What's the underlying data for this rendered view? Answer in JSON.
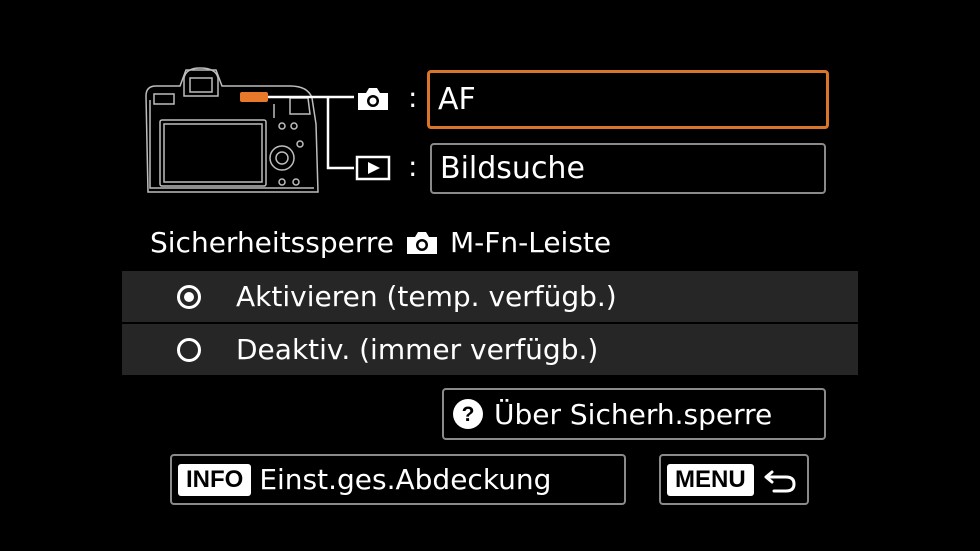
{
  "assignments": {
    "shooting": {
      "icon": "camera-icon",
      "separator": ":",
      "value": "AF"
    },
    "playback": {
      "icon": "playback-icon",
      "separator": ":",
      "value": "Bildsuche"
    }
  },
  "section": {
    "title_prefix": "Sicherheitssperre",
    "title_icon": "camera-icon",
    "title_suffix": "M-Fn-Leiste"
  },
  "options": [
    {
      "label": "Aktivieren (temp. verfügb.)",
      "selected": true
    },
    {
      "label": "Deaktiv. (immer verfügb.)",
      "selected": false
    }
  ],
  "help_button": {
    "icon": "question-icon",
    "label": "Über Sicherh.sperre"
  },
  "footer": {
    "info_key": "INFO",
    "info_label": "Einst.ges.Abdeckung",
    "menu_key": "MENU",
    "menu_icon": "back-arrow-icon"
  },
  "colors": {
    "background": "#000000",
    "row_background": "#262626",
    "selected_border": "#d9752b",
    "highlight_bar": "#e8792a",
    "border": "#8a8a8a"
  }
}
